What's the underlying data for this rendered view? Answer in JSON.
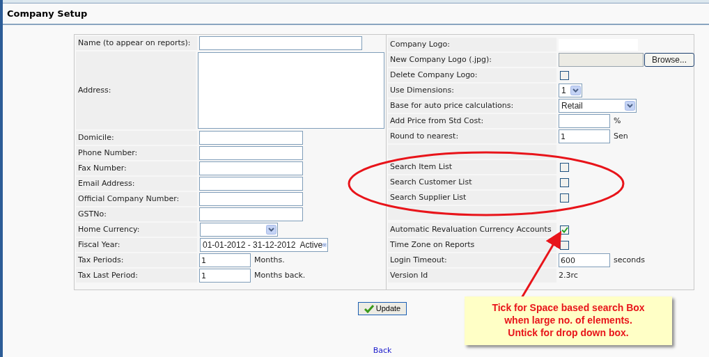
{
  "page_title": "Company Setup",
  "left_fields": [
    {
      "kind": "text",
      "label": "Name (to appear on reports):"
    },
    {
      "kind": "textarea",
      "label": "Address:"
    },
    {
      "kind": "text",
      "label": "Domicile:"
    },
    {
      "kind": "text",
      "label": "Phone Number:"
    },
    {
      "kind": "text",
      "label": "Fax Number:"
    },
    {
      "kind": "text",
      "label": "Email Address:"
    },
    {
      "kind": "text",
      "label": "Official Company Number:"
    },
    {
      "kind": "text",
      "label": "GSTNo:"
    },
    {
      "kind": "select",
      "label": "Home Currency:"
    },
    {
      "kind": "select",
      "label": "Fiscal Year:",
      "value": "01-01-2012 - 31-12-2012  Active"
    },
    {
      "kind": "text",
      "label": "Tax Periods:",
      "value": "1",
      "unit": "Months."
    },
    {
      "kind": "text",
      "label": "Tax Last Period:",
      "value": "1",
      "unit": "Months back."
    }
  ],
  "right_fields": [
    {
      "kind": "logo",
      "label": "Company Logo:"
    },
    {
      "kind": "file",
      "label": "New Company Logo (.jpg):",
      "button": "Browse..."
    },
    {
      "kind": "checkbox",
      "label": "Delete Company Logo:",
      "checked": false
    },
    {
      "kind": "select",
      "label": "Use Dimensions:",
      "value": "1"
    },
    {
      "kind": "select",
      "label": "Base for auto price calculations:",
      "value": "Retail"
    },
    {
      "kind": "text",
      "label": "Add Price from Std Cost:",
      "unit": "%"
    },
    {
      "kind": "text",
      "label": "Round to nearest:",
      "value": "1",
      "unit": "Sen"
    },
    {
      "kind": "spacer"
    },
    {
      "kind": "checkbox",
      "label": "Search Item List",
      "checked": false
    },
    {
      "kind": "checkbox",
      "label": "Search Customer List",
      "checked": false
    },
    {
      "kind": "checkbox",
      "label": "Search Supplier List",
      "checked": false
    },
    {
      "kind": "spacer"
    },
    {
      "kind": "checkbox",
      "label": "Automatic Revaluation Currency Accounts",
      "checked": true
    },
    {
      "kind": "checkbox",
      "label": "Time Zone on Reports",
      "checked": false
    },
    {
      "kind": "text",
      "label": "Login Timeout:",
      "value": "600",
      "unit": "seconds"
    },
    {
      "kind": "static",
      "label": "Version Id",
      "value": "2.3rc"
    }
  ],
  "update_button": "Update",
  "back_link": "Back",
  "callout": "Tick for Space based search Box\nwhen large no. of elements.\nUntick for drop down box."
}
